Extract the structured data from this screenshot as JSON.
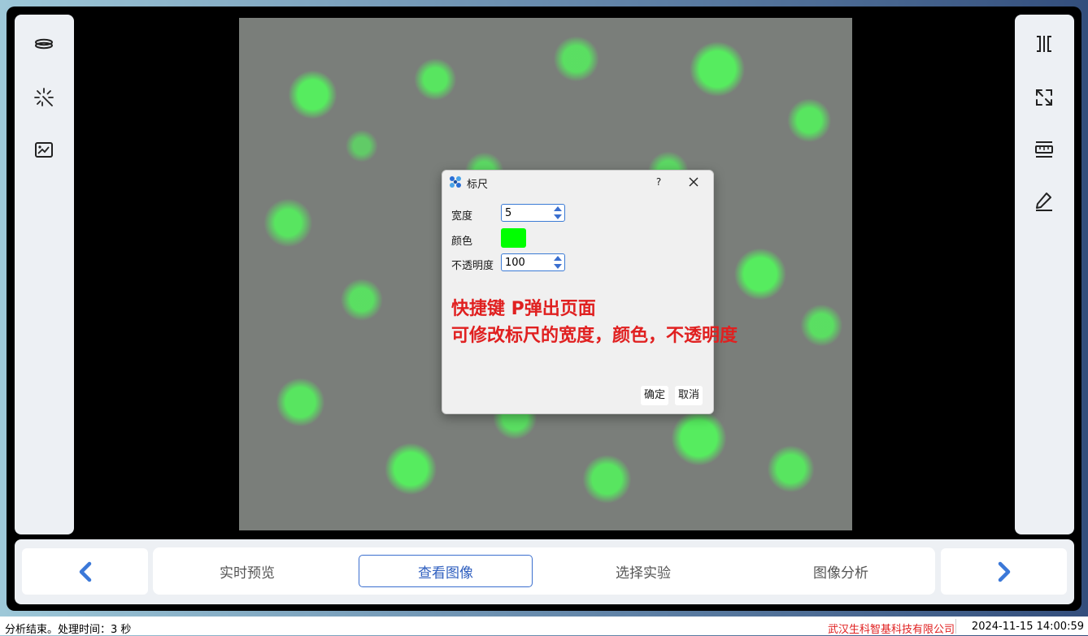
{
  "left_toolbar": {
    "tools": [
      {
        "icon": "layers-icon"
      },
      {
        "icon": "magic-wand-icon"
      },
      {
        "icon": "image-edit-icon"
      }
    ]
  },
  "right_toolbar": {
    "tools": [
      {
        "icon": "split-view-icon"
      },
      {
        "icon": "fullscreen-icon"
      },
      {
        "icon": "ruler-icon"
      },
      {
        "icon": "pen-icon"
      }
    ]
  },
  "dialog": {
    "title": "标尺",
    "help": "?",
    "width_label": "宽度",
    "width_value": "5",
    "color_label": "颜色",
    "color_value": "#00ff00",
    "opacity_label": "不透明度",
    "opacity_value": "100",
    "note_line1": "快捷键 P弹出页面",
    "note_line2": "可修改标尺的宽度，颜色，不透明度",
    "ok": "确定",
    "cancel": "取消"
  },
  "nav": {
    "tabs": [
      "实时预览",
      "查看图像",
      "选择实验",
      "图像分析"
    ],
    "active_tab": "查看图像"
  },
  "status": {
    "message": "分析结束。处理时间：3 秒",
    "company": "武汉生科智基科技有限公司",
    "datetime": "2024-11-15 14:00:59"
  },
  "colors": {
    "accent": "#3b6fcf",
    "note_red": "#e02020",
    "fluorescence_green": "#50ff5a"
  }
}
